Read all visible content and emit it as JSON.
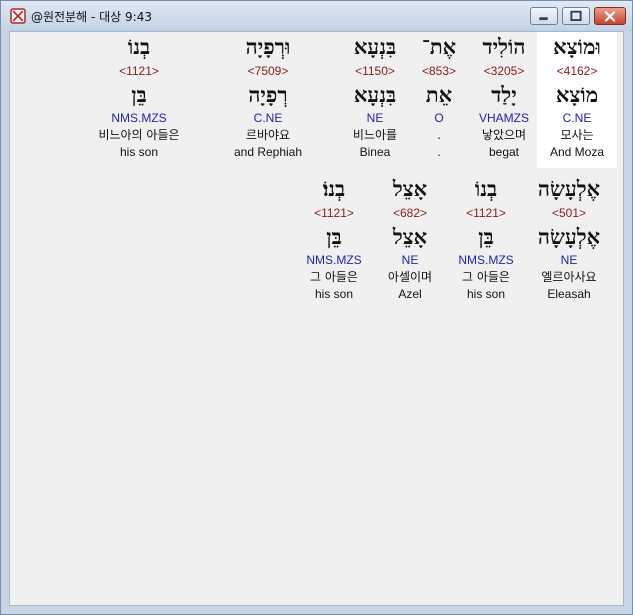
{
  "window": {
    "title": "@원전분해 - 대상 9:43"
  },
  "colors": {
    "strong": "#8b1a1a",
    "morph": "#2222aa",
    "highlight": "#ffffff"
  },
  "rows": [
    [
      {
        "heb": "וּמוֹצָא",
        "strong": "<4162>",
        "lemma": "מוֹצָא",
        "morph": "C.NE",
        "kor": "모사는",
        "eng": "And Moza"
      },
      {
        "heb": "הוֹלִיד",
        "strong": "<3205>",
        "lemma": "יָלַד",
        "morph": "VHAMZS",
        "kor": "낳았으며",
        "eng": "begat"
      },
      {
        "heb": "אֶת־",
        "strong": "<853>",
        "lemma": "אֵת",
        "morph": "O",
        "kor": ".",
        "eng": "."
      },
      {
        "heb": "בִּנְעָא",
        "strong": "<1150>",
        "lemma": "בִּנְעָא",
        "morph": "NE",
        "kor": "비느아를",
        "eng": "Binea"
      },
      {
        "heb": "וּרְפָיָה",
        "strong": "<7509>",
        "lemma": "רְפָיָה",
        "morph": "C.NE",
        "kor": "르바야요",
        "eng": "and Rephiah"
      },
      {
        "heb": "בְנוֹ",
        "strong": "<1121>",
        "lemma": "בֵּן",
        "morph": "NMS.MZS",
        "kor": "비느아의 아들은",
        "eng": "his son"
      }
    ],
    [
      {
        "heb": "אֶלְעָשָׂה",
        "strong": "<501>",
        "lemma": "אֶלְעָשָׂה",
        "morph": "NE",
        "kor": "엘르아사요",
        "eng": "Eleasah"
      },
      {
        "heb": "בְנוֹ",
        "strong": "<1121>",
        "lemma": "בֵּן",
        "morph": "NMS.MZS",
        "kor": "그 아들은",
        "eng": "his son"
      },
      {
        "heb": "אָצֵל",
        "strong": "<682>",
        "lemma": "אָצֵל",
        "morph": "NE",
        "kor": "아셀이며",
        "eng": "Azel"
      },
      {
        "heb": "בְנוֹ׃",
        "strong": "<1121>",
        "lemma": "בֵּן",
        "morph": "NMS.MZS",
        "kor": "그 아들은",
        "eng": "his son"
      }
    ]
  ]
}
